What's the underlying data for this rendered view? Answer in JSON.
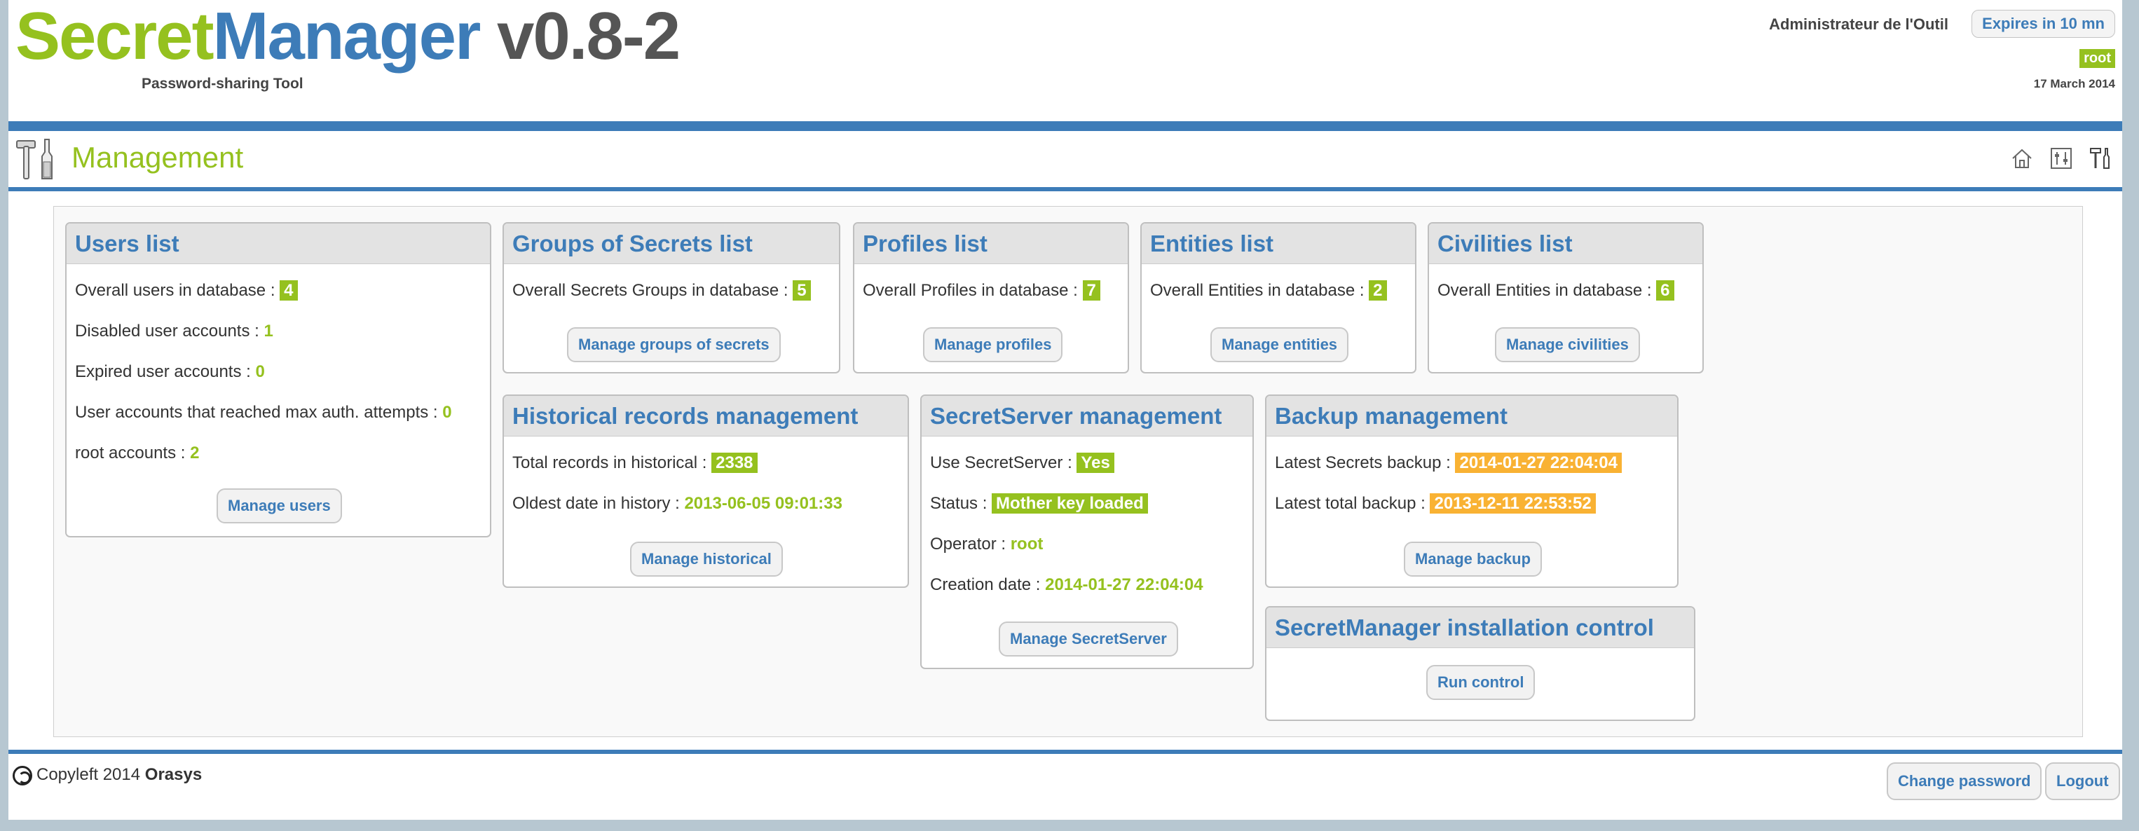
{
  "header": {
    "logo_part1": "Secret",
    "logo_part2": "Manager",
    "logo_part3": "v0.8-2",
    "tagline": "Password-sharing Tool",
    "admin_name": "Administrateur de l'Outil",
    "expires_label": "Expires in 10 mn",
    "user_badge": "root",
    "date": "17 March 2014"
  },
  "page": {
    "title": "Management",
    "nav_icons": [
      "home-icon",
      "secrets-icon",
      "tools-icon"
    ]
  },
  "users": {
    "title": "Users list",
    "overall_label": "Overall users in database :",
    "overall_value": "4",
    "disabled_label": "Disabled user accounts :",
    "disabled_value": "1",
    "expired_label": "Expired user accounts :",
    "expired_value": "0",
    "maxauth_label": "User accounts that reached max auth. attempts :",
    "maxauth_value": "0",
    "root_label": "root accounts :",
    "root_value": "2",
    "button": "Manage users"
  },
  "groups": {
    "title": "Groups of Secrets list",
    "overall_label": "Overall Secrets Groups in database :",
    "overall_value": "5",
    "button": "Manage groups of secrets"
  },
  "profiles": {
    "title": "Profiles list",
    "overall_label": "Overall Profiles in database :",
    "overall_value": "7",
    "button": "Manage profiles"
  },
  "entities": {
    "title": "Entities list",
    "overall_label": "Overall Entities in database :",
    "overall_value": "2",
    "button": "Manage entities"
  },
  "civilities": {
    "title": "Civilities list",
    "overall_label": "Overall Entities in database :",
    "overall_value": "6",
    "button": "Manage civilities"
  },
  "historical": {
    "title": "Historical records management",
    "total_label": "Total records in historical :",
    "total_value": "2338",
    "oldest_label": "Oldest date in history :",
    "oldest_value": "2013-06-05 09:01:33",
    "button": "Manage historical"
  },
  "secretserver": {
    "title": "SecretServer management",
    "use_label": "Use SecretServer :",
    "use_value": "Yes",
    "status_label": "Status :",
    "status_value": "Mother key loaded",
    "operator_label": "Operator :",
    "operator_value": "root",
    "creation_label": "Creation date :",
    "creation_value": "2014-01-27 22:04:04",
    "button": "Manage SecretServer"
  },
  "backup": {
    "title": "Backup management",
    "secrets_label": "Latest Secrets backup :",
    "secrets_value": "2014-01-27 22:04:04",
    "total_label": "Latest total backup :",
    "total_value": "2013-12-11 22:53:52",
    "button": "Manage backup"
  },
  "install": {
    "title": "SecretManager installation control",
    "button": "Run control"
  },
  "footer": {
    "copyleft": "Copyleft 2014",
    "company": "Orasys",
    "change_password": "Change password",
    "logout": "Logout"
  },
  "colors": {
    "brand_green": "#95c11f",
    "brand_blue": "#3d7cb8",
    "badge_orange": "#f9b233"
  }
}
